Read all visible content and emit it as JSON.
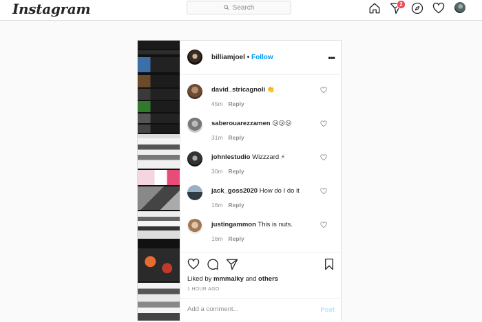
{
  "nav": {
    "logo": "Instagram",
    "search_placeholder": "Search",
    "notification_count": "2",
    "icons": [
      "home-icon",
      "direct-icon",
      "explore-icon",
      "activity-heart-icon",
      "profile-avatar"
    ]
  },
  "post": {
    "author": "billiamjoel",
    "separator": "•",
    "follow_label": "Follow",
    "more_label": "•••",
    "comments": [
      {
        "user": "david_stricagnoli",
        "text": "",
        "emoji": "👏",
        "time": "45m",
        "reply": "Reply"
      },
      {
        "user": "saberouarezzamen",
        "text": "",
        "emoji": "😕😕😕",
        "time": "31m",
        "reply": "Reply"
      },
      {
        "user": "johnlestudio",
        "text": "Wizzzard",
        "emoji": "⚡",
        "time": "30m",
        "reply": "Reply"
      },
      {
        "user": "jack_goss2020",
        "text": "How do I do it",
        "emoji": "",
        "time": "16m",
        "reply": "Reply"
      },
      {
        "user": "justingammon",
        "text": "This is nuts.",
        "emoji": "",
        "time": "16m",
        "reply": "Reply"
      }
    ],
    "liked_by_prefix": "Liked by",
    "liked_by_user": "mmmalky",
    "liked_by_and": "and",
    "liked_by_others": "others",
    "time_ago": "1 HOUR AGO",
    "comment_placeholder": "Add a comment...",
    "post_label": "Post"
  },
  "colors": {
    "link_blue": "#0095f6",
    "badge_red": "#ed4956",
    "post_button_disabled": "#b2dffc",
    "border": "#dbdbdb"
  }
}
